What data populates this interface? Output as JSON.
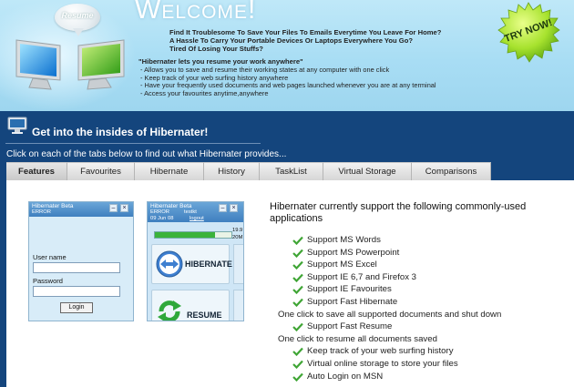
{
  "hero": {
    "bubble_text": "Resume",
    "welcome": "Welcome!",
    "questions": [
      "Find It Troublesome To Save Your Files To Emails Everytime You Leave For Home?",
      "A Hassle To Carry Your Portable Devices Or Laptops Everywhere You Go?",
      "Tired Of Losing Your Stuffs?"
    ],
    "quote": "\"Hibernater lets you resume your work anywhere\"",
    "features": [
      "- Allows you to save and resume their working states at any computer with one click",
      "- Keep track of your web surfing history anywhere",
      "- Have your frequently used documents and web pages launched whenever you are at any terminal",
      "- Access your favourites anytime,anywhere"
    ],
    "try_now": "TRY NOW!"
  },
  "section": {
    "title": "Get into the insides of Hibernater!",
    "instruction": "Click on each of the tabs below to find out what Hibernater provides..."
  },
  "tabs": [
    {
      "label": "Features",
      "active": true
    },
    {
      "label": "Favourites",
      "active": false
    },
    {
      "label": "Hibernate",
      "active": false
    },
    {
      "label": "History",
      "active": false
    },
    {
      "label": "TaskList",
      "active": false
    },
    {
      "label": "Virtual Storage",
      "active": false
    },
    {
      "label": "Comparisons",
      "active": false
    }
  ],
  "mock_login": {
    "title": "Hibernater Beta",
    "status": "ERROR",
    "user_label": "User name",
    "password_label": "Password",
    "login_button": "Login"
  },
  "mock_main": {
    "title": "Hibernater Beta",
    "status": "ERROR",
    "user": "testkt",
    "date": "09 Jun 08",
    "logout": "logout",
    "side_top": "19.9",
    "side_bottom": "20M",
    "progress": 0.78,
    "hibernate_label": "HIBERNATE",
    "resume_label": "RESUME"
  },
  "features_panel": {
    "heading": "Hibernater currently support the following commonly-used applications",
    "items": [
      {
        "text": "Support MS Words",
        "check": true
      },
      {
        "text": "Support MS Powerpoint",
        "check": true
      },
      {
        "text": "Support MS Excel",
        "check": true
      },
      {
        "text": "Support IE 6,7 and Firefox 3",
        "check": true
      },
      {
        "text": "Support IE Favourites",
        "check": true
      },
      {
        "text": "Support Fast Hibernate",
        "check": true
      },
      {
        "text": "One click to save all supported documents and shut down",
        "check": false
      },
      {
        "text": "Support Fast Resume",
        "check": true
      },
      {
        "text": "One click to resume all documents saved",
        "check": false
      },
      {
        "text": "Keep track of your web surfing history",
        "check": true
      },
      {
        "text": "Virtual online storage to store your files",
        "check": true
      },
      {
        "text": "Auto Login on MSN",
        "check": true
      }
    ]
  },
  "colors": {
    "hero_bg": "#a8ddf4",
    "section_bg": "#14457d",
    "check_green": "#3fa535",
    "try_now_green": "#9ee02e"
  }
}
